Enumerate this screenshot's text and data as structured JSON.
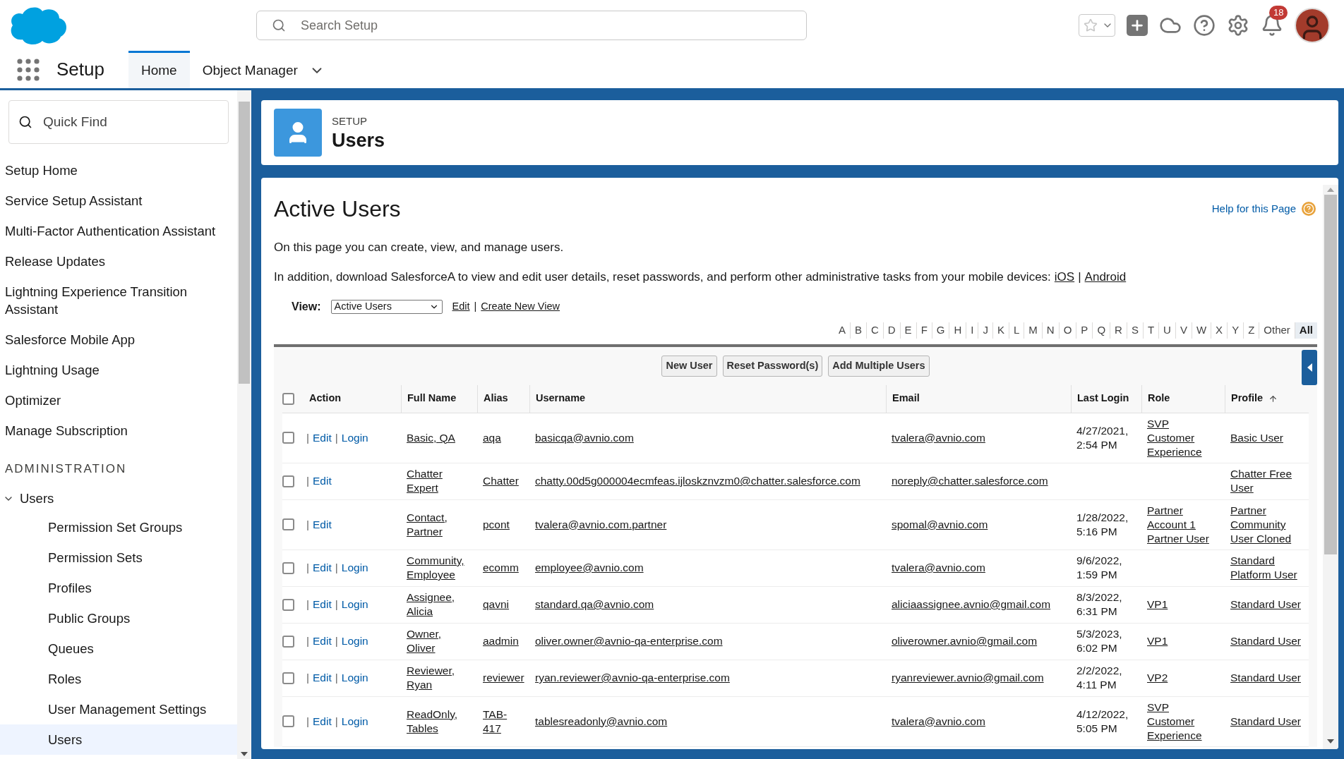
{
  "header": {
    "search": {
      "placeholder": "Search Setup"
    },
    "notification_count": "18"
  },
  "nav": {
    "app_name": "Setup",
    "tabs": [
      {
        "label": "Home",
        "selected": true,
        "dropdown": false
      },
      {
        "label": "Object Manager",
        "selected": false,
        "dropdown": true
      }
    ]
  },
  "sidebar": {
    "search": {
      "placeholder": "Quick Find"
    },
    "items": [
      {
        "label": "Setup Home"
      },
      {
        "label": "Service Setup Assistant"
      },
      {
        "label": "Multi-Factor Authentication Assistant"
      },
      {
        "label": "Release Updates"
      },
      {
        "label": "Lightning Experience Transition Assistant"
      },
      {
        "label": "Salesforce Mobile App"
      },
      {
        "label": "Lightning Usage"
      },
      {
        "label": "Optimizer"
      },
      {
        "label": "Manage Subscription"
      }
    ],
    "section_heading": "ADMINISTRATION",
    "tree": [
      {
        "label": "Users",
        "expanded": true,
        "children": [
          {
            "label": "Permission Set Groups",
            "selected": false
          },
          {
            "label": "Permission Sets",
            "selected": false
          },
          {
            "label": "Profiles",
            "selected": false
          },
          {
            "label": "Public Groups",
            "selected": false
          },
          {
            "label": "Queues",
            "selected": false
          },
          {
            "label": "Roles",
            "selected": false
          },
          {
            "label": "User Management Settings",
            "selected": false
          },
          {
            "label": "Users",
            "selected": true
          }
        ]
      }
    ]
  },
  "page_header": {
    "eyebrow": "SETUP",
    "title": "Users"
  },
  "content": {
    "title": "Active Users",
    "help_link": "Help for this Page",
    "intro": "On this page you can create, view, and manage users.",
    "download_text": "In addition, download SalesforceA to view and edit user details, reset passwords, and perform other administrative tasks from your mobile devices:",
    "download_links": [
      {
        "label": "iOS"
      },
      {
        "sep": "|",
        "label": "Android"
      }
    ],
    "view": {
      "label": "View:",
      "value": "Active Users",
      "links": [
        {
          "label": "Edit"
        },
        {
          "sep": "|",
          "label": "Create New View"
        }
      ]
    },
    "alphabet": [
      {
        "label": "A",
        "selected": false
      },
      {
        "label": "B",
        "selected": false
      },
      {
        "label": "C",
        "selected": false
      },
      {
        "label": "D",
        "selected": false
      },
      {
        "label": "E",
        "selected": false
      },
      {
        "label": "F",
        "selected": false
      },
      {
        "label": "G",
        "selected": false
      },
      {
        "label": "H",
        "selected": false
      },
      {
        "label": "I",
        "selected": false
      },
      {
        "label": "J",
        "selected": false
      },
      {
        "label": "K",
        "selected": false
      },
      {
        "label": "L",
        "selected": false
      },
      {
        "label": "M",
        "selected": false
      },
      {
        "label": "N",
        "selected": false
      },
      {
        "label": "O",
        "selected": false
      },
      {
        "label": "P",
        "selected": false
      },
      {
        "label": "Q",
        "selected": false
      },
      {
        "label": "R",
        "selected": false
      },
      {
        "label": "S",
        "selected": false
      },
      {
        "label": "T",
        "selected": false
      },
      {
        "label": "U",
        "selected": false
      },
      {
        "label": "V",
        "selected": false
      },
      {
        "label": "W",
        "selected": false
      },
      {
        "label": "X",
        "selected": false
      },
      {
        "label": "Y",
        "selected": false
      },
      {
        "label": "Z",
        "selected": false
      },
      {
        "label": "Other",
        "selected": false
      },
      {
        "label": "All",
        "selected": true
      }
    ],
    "buttons": [
      "New User",
      "Reset Password(s)",
      "Add Multiple Users"
    ],
    "table": {
      "select_all_checked": false,
      "columns": [
        {
          "label": "Action"
        },
        {
          "label": "Full Name"
        },
        {
          "label": "Alias"
        },
        {
          "label": "Username"
        },
        {
          "label": "Email"
        },
        {
          "label": "Last Login"
        },
        {
          "label": "Role"
        },
        {
          "label": "Profile",
          "sorted": true
        }
      ],
      "rows": [
        {
          "checked": false,
          "actions": [
            {
              "sep": "|",
              "label": "Edit"
            },
            {
              "sep": "|",
              "label": "Login"
            }
          ],
          "full_name": "Basic, QA",
          "alias": "aqa",
          "username": "basicqa@avnio.com",
          "email": "tvalera@avnio.com",
          "last_login": "4/27/2021, 2:54 PM",
          "role": "SVP Customer Experience",
          "profile": "Basic User"
        },
        {
          "checked": false,
          "actions": [
            {
              "sep": "|",
              "label": "Edit"
            }
          ],
          "full_name": "Chatter Expert",
          "alias": "Chatter",
          "username": "chatty.00d5g000004ecmfeas.ijloskznvzm0@chatter.salesforce.com",
          "email": "noreply@chatter.salesforce.com",
          "last_login": "",
          "role": "",
          "profile": "Chatter Free User"
        },
        {
          "checked": false,
          "actions": [
            {
              "sep": "|",
              "label": "Edit"
            }
          ],
          "full_name": "Contact, Partner",
          "alias": "pcont",
          "username": "tvalera@avnio.com.partner",
          "email": "spomal@avnio.com",
          "last_login": "1/28/2022, 5:16 PM",
          "role": "Partner Account 1 Partner User",
          "profile": "Partner Community User Cloned"
        },
        {
          "checked": false,
          "actions": [
            {
              "sep": "|",
              "label": "Edit"
            },
            {
              "sep": "|",
              "label": "Login"
            }
          ],
          "full_name": "Community, Employee",
          "alias": "ecomm",
          "username": "employee@avnio.com",
          "email": "tvalera@avnio.com",
          "last_login": "9/6/2022, 1:59 PM",
          "role": "",
          "profile": "Standard Platform User"
        },
        {
          "checked": false,
          "actions": [
            {
              "sep": "|",
              "label": "Edit"
            },
            {
              "sep": "|",
              "label": "Login"
            }
          ],
          "full_name": "Assignee, Alicia",
          "alias": "qavni",
          "username": "standard.qa@avnio.com",
          "email": "aliciaassignee.avnio@gmail.com",
          "last_login": "8/3/2022, 6:31 PM",
          "role": "VP1",
          "profile": "Standard User"
        },
        {
          "checked": false,
          "actions": [
            {
              "sep": "|",
              "label": "Edit"
            },
            {
              "sep": "|",
              "label": "Login"
            }
          ],
          "full_name": "Owner, Oliver",
          "alias": "aadmin",
          "username": "oliver.owner@avnio-qa-enterprise.com",
          "email": "oliverowner.avnio@gmail.com",
          "last_login": "5/3/2023, 6:02 PM",
          "role": "VP1",
          "profile": "Standard User"
        },
        {
          "checked": false,
          "actions": [
            {
              "sep": "|",
              "label": "Edit"
            },
            {
              "sep": "|",
              "label": "Login"
            }
          ],
          "full_name": "Reviewer, Ryan",
          "alias": "reviewer",
          "username": "ryan.reviewer@avnio-qa-enterprise.com",
          "email": "ryanreviewer.avnio@gmail.com",
          "last_login": "2/2/2022, 4:11 PM",
          "role": "VP2",
          "profile": "Standard User"
        },
        {
          "checked": false,
          "actions": [
            {
              "sep": "|",
              "label": "Edit"
            },
            {
              "sep": "|",
              "label": "Login"
            }
          ],
          "full_name": "ReadOnly, Tables",
          "alias": "TAB-417",
          "username": "tablesreadonly@avnio.com",
          "email": "tvalera@avnio.com",
          "last_login": "4/12/2022, 5:05 PM",
          "role": "SVP Customer Experience",
          "profile": "Standard User"
        }
      ]
    }
  }
}
